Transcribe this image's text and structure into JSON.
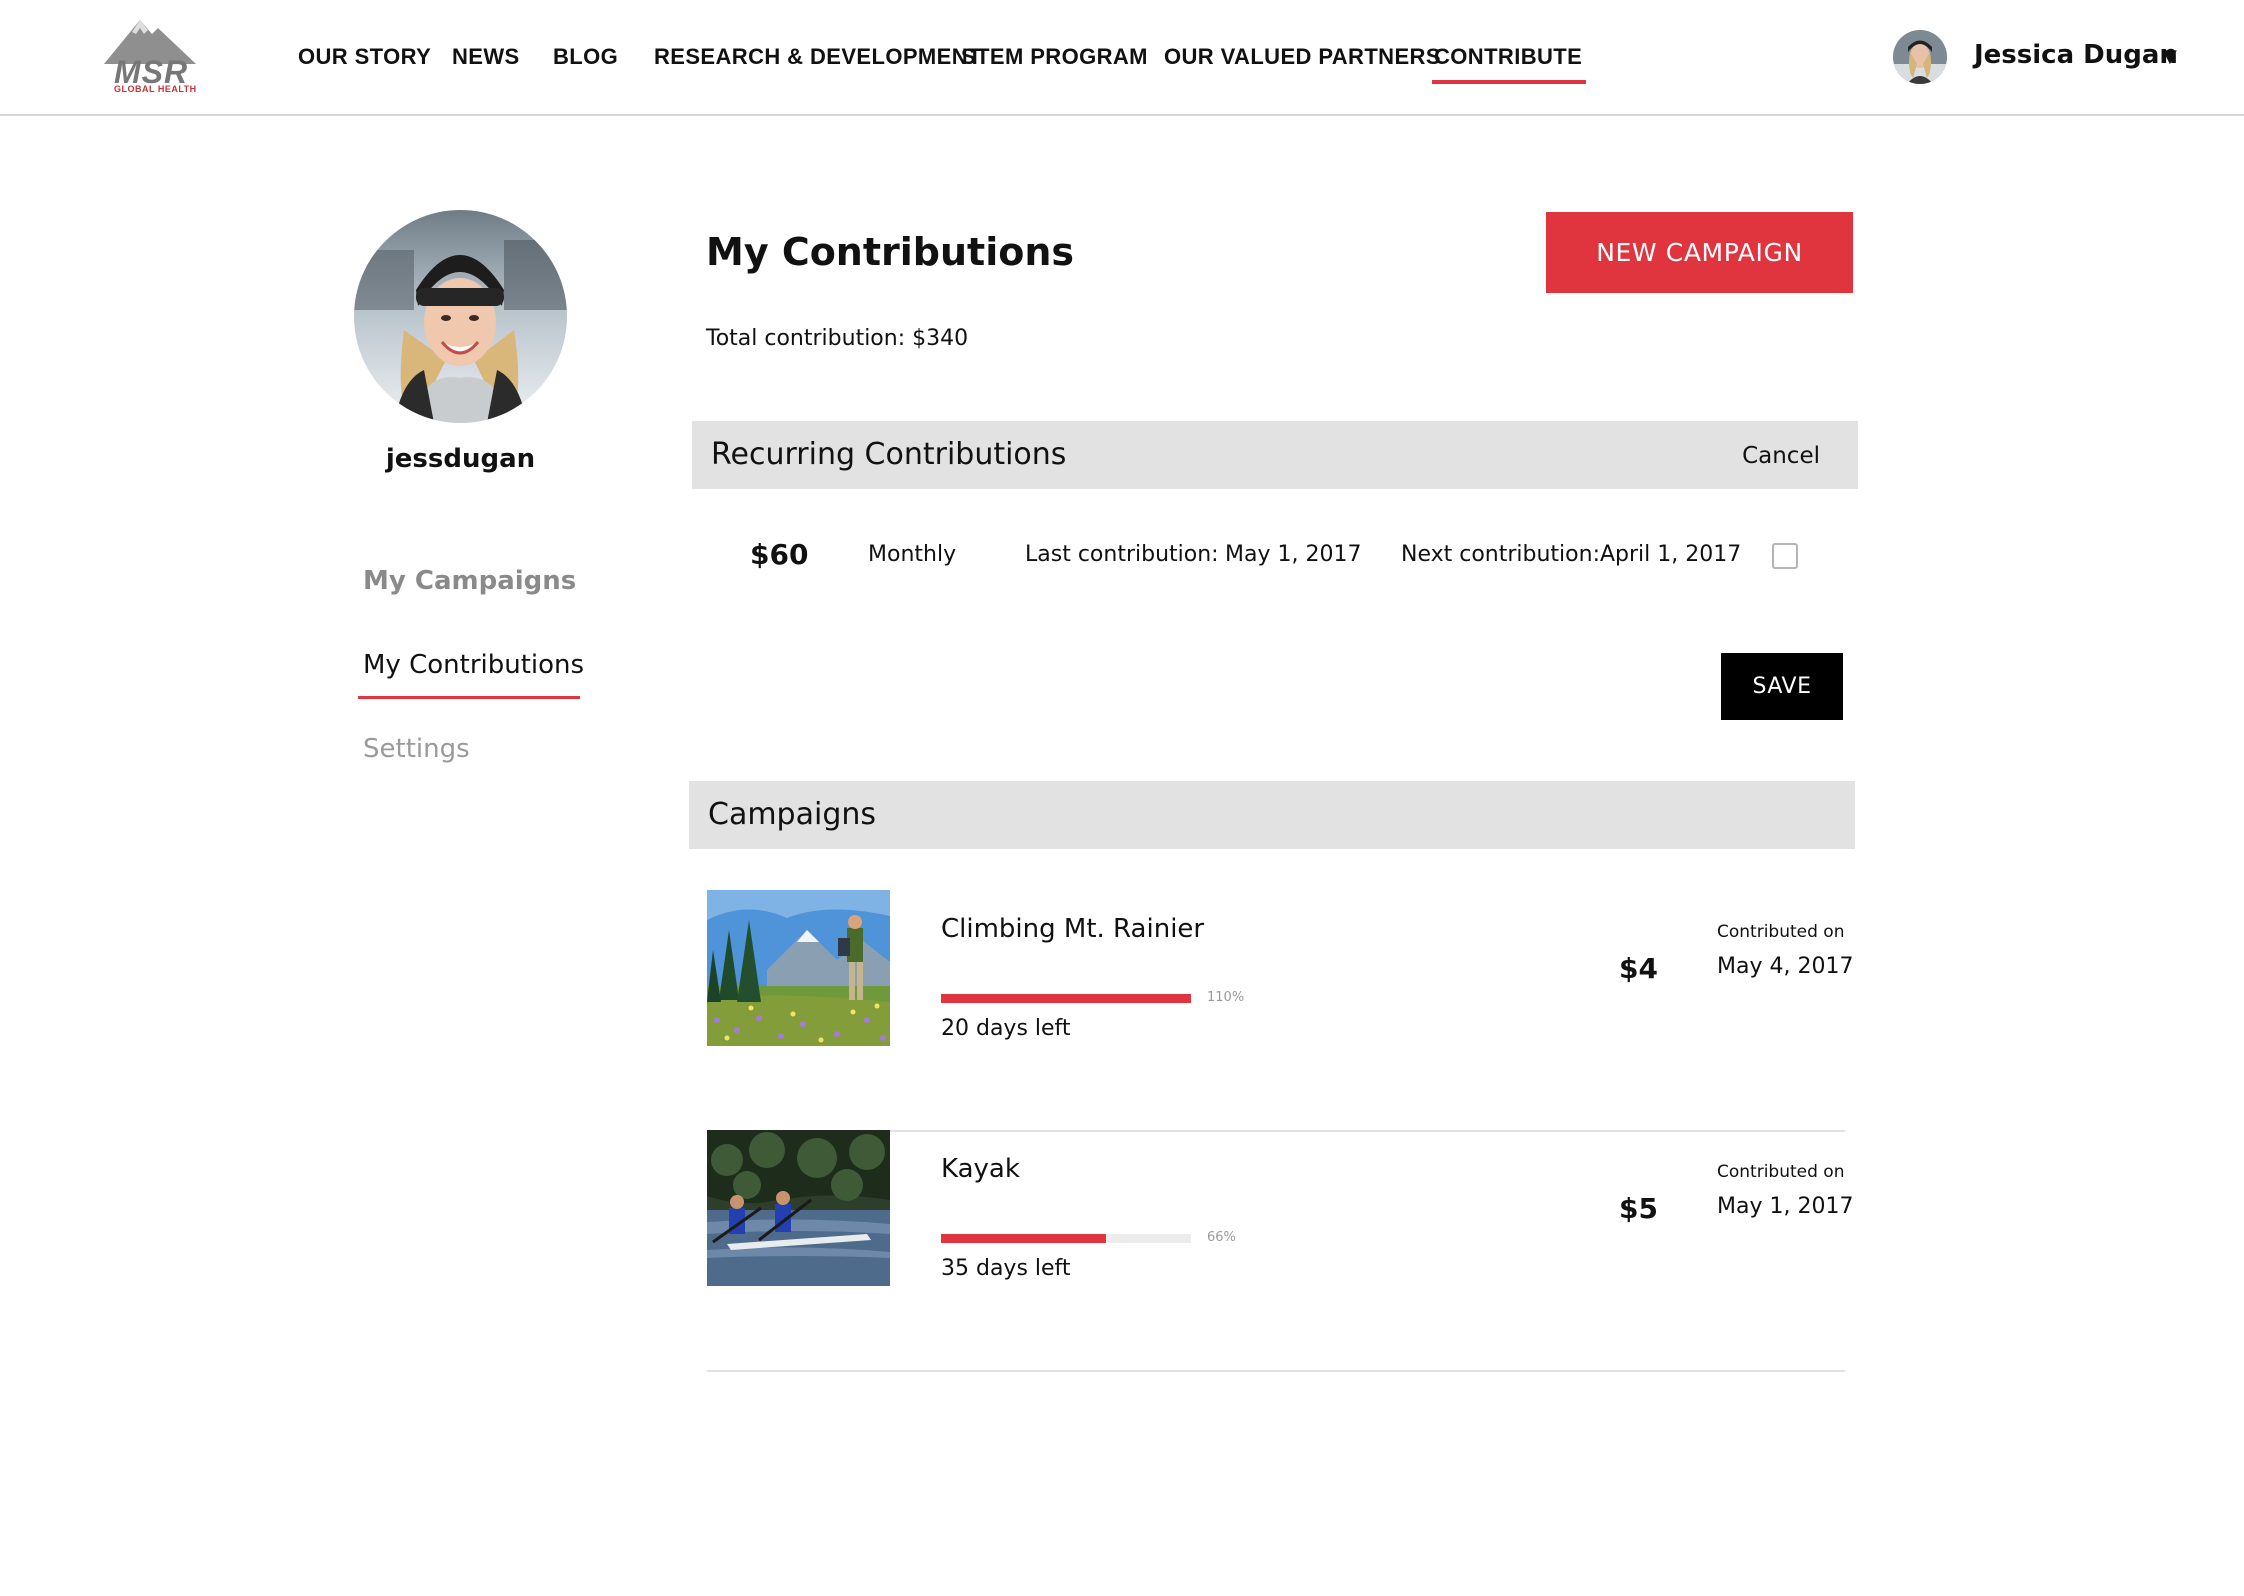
{
  "brand": {
    "logo_text": "MSR",
    "logo_subtext": "GLOBAL HEALTH"
  },
  "nav": {
    "items": [
      {
        "label": "OUR STORY"
      },
      {
        "label": "NEWS"
      },
      {
        "label": "BLOG"
      },
      {
        "label": "RESEARCH & DEVELOPMENT"
      },
      {
        "label": "STEM PROGRAM"
      },
      {
        "label": "OUR VALUED PARTNERS"
      },
      {
        "label": "CONTRIBUTE",
        "active": true
      }
    ]
  },
  "user": {
    "name": "Jessica Dugan",
    "caret": "▼"
  },
  "sidebar": {
    "username": "jessdugan",
    "links": [
      {
        "label": "My Campaigns"
      },
      {
        "label": "My Contributions",
        "active": true
      },
      {
        "label": "Settings"
      }
    ]
  },
  "main": {
    "title": "My Contributions",
    "total": "Total contribution: $340",
    "new_campaign_label": "NEW CAMPAIGN",
    "recurring": {
      "title": "Recurring Contributions",
      "cancel_label": "Cancel",
      "row": {
        "amount": "$60",
        "frequency": "Monthly",
        "last_label": "Last contribution:",
        "last_value": "May 1, 2017",
        "next_label": "Next contribution:",
        "next_value": "April 1, 2017",
        "checked": false
      },
      "save_label": "SAVE"
    },
    "campaigns": {
      "title": "Campaigns",
      "items": [
        {
          "name": "Climbing Mt. Rainier",
          "progress_percent": 110,
          "progress_label": "110%",
          "days_left": "20 days left",
          "amount": "$4",
          "contributed_label": "Contributed on",
          "contributed_date": "May 4, 2017"
        },
        {
          "name": "Kayak",
          "progress_percent": 66,
          "progress_label": "66%",
          "days_left": "35 days left",
          "amount": "$5",
          "contributed_label": "Contributed on",
          "contributed_date": "May 1, 2017"
        }
      ]
    }
  },
  "colors": {
    "accent": "#e0353f",
    "bar_gray": "#e2e2e2",
    "muted": "#8a8a8a"
  }
}
